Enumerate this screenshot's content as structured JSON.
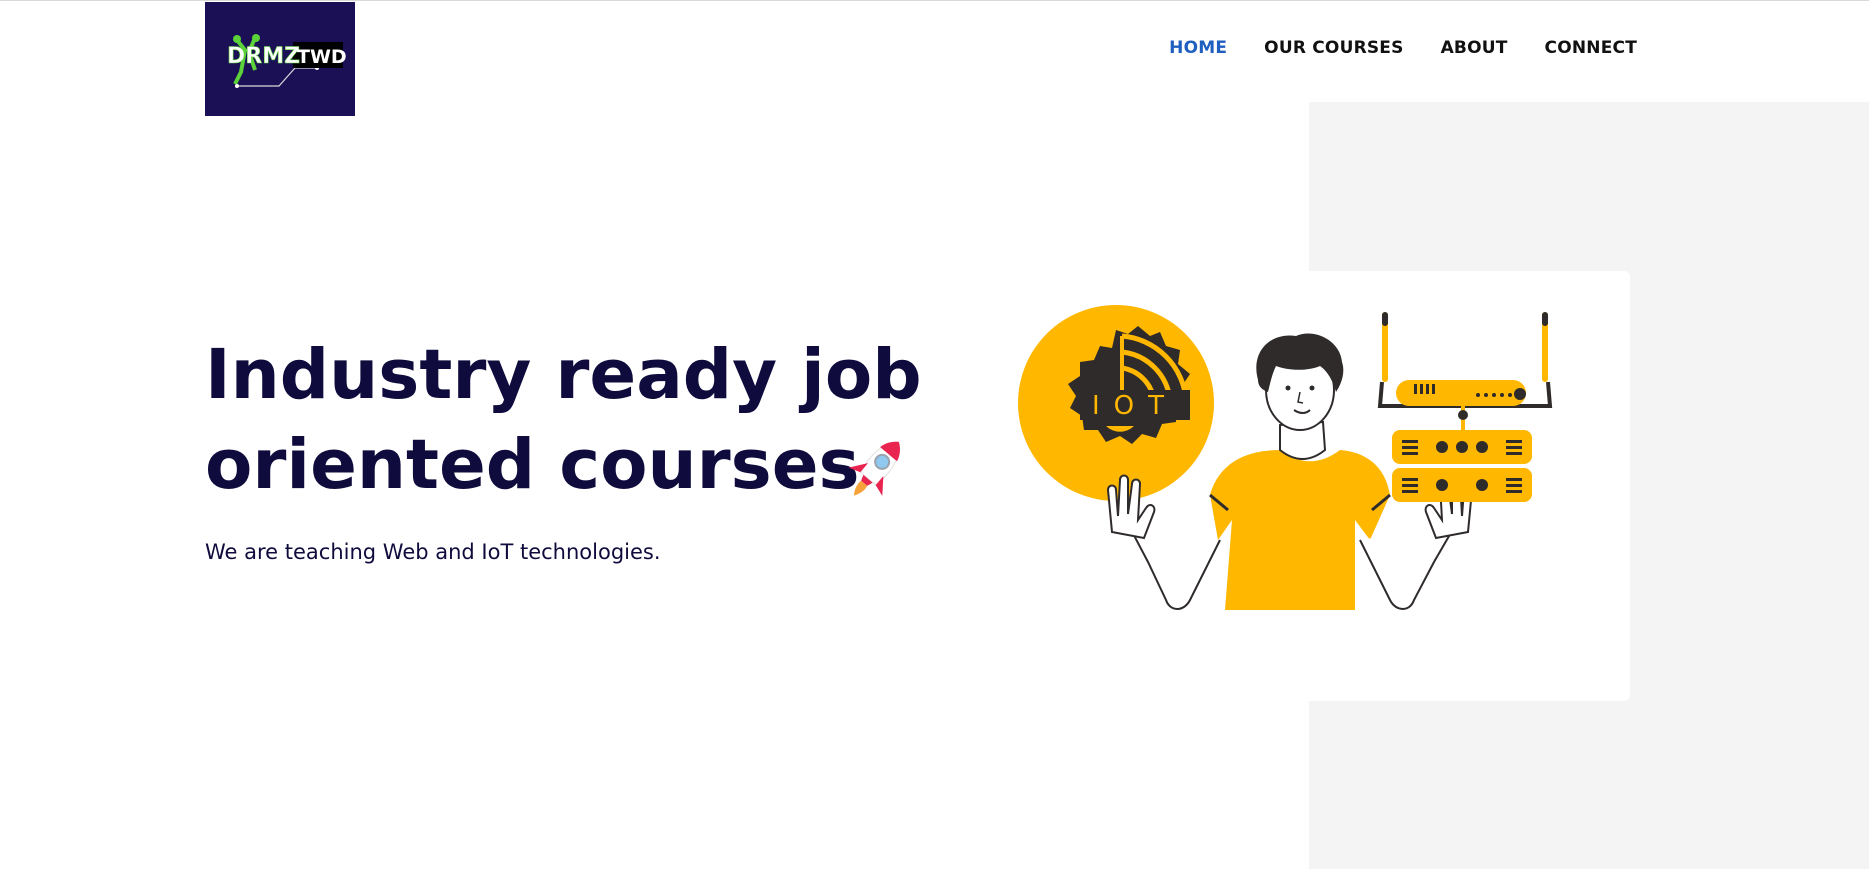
{
  "header": {
    "logo_text_left": "DRMZ",
    "logo_text_right": "TWD",
    "nav": [
      {
        "label": "HOME",
        "active": true
      },
      {
        "label": "OUR COURSES",
        "active": false
      },
      {
        "label": "ABOUT",
        "active": false
      },
      {
        "label": "CONNECT",
        "active": false
      }
    ]
  },
  "hero": {
    "title_line1": "Industry ready job",
    "title_line2": "oriented courses",
    "subtitle": "We are teaching Web and IoT technologies.",
    "illustration_label": "IOT"
  },
  "colors": {
    "title": "#0f0c3d",
    "nav_active": "#1f5fbf",
    "logo_bg": "#1b0f55",
    "accent": "#ffb700",
    "panel": "#f4f4f4"
  },
  "icons": [
    "rocket-icon",
    "iot-gear-icon",
    "router-icon",
    "server-icon"
  ]
}
